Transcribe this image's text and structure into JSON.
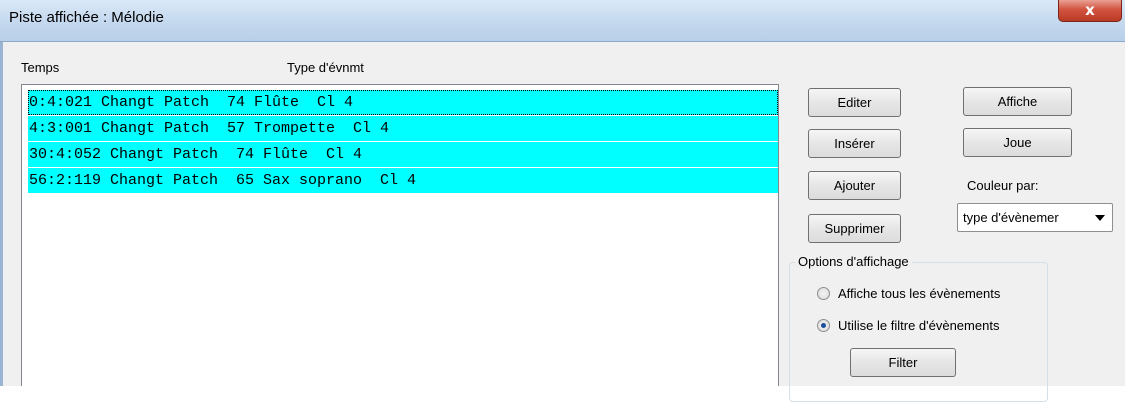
{
  "window": {
    "title": "Piste affichée : Mélodie",
    "close_glyph": "x"
  },
  "list": {
    "columns": [
      "Temps",
      "Type d'évnmt"
    ],
    "rows": [
      "0:4:021 Changt Patch  74 Flûte  Cl 4",
      "4:3:001 Changt Patch  57 Trompette  Cl 4",
      "30:4:052 Changt Patch  74 Flûte  Cl 4",
      "56:2:119 Changt Patch  65 Sax soprano  Cl 4"
    ],
    "highlight_color": "#00ffff"
  },
  "buttons": {
    "edit": "Editer",
    "insert": "Insérer",
    "add": "Ajouter",
    "delete": "Supprimer",
    "show": "Affiche",
    "play": "Joue",
    "filter": "Filter"
  },
  "color_by": {
    "label": "Couleur par:",
    "selected": "type d'évènemer"
  },
  "display_options": {
    "label": "Options d'affichage",
    "show_all": "Affiche tous les évènements",
    "use_filter": "Utilise le filtre d'évènements",
    "selected": "use_filter"
  }
}
